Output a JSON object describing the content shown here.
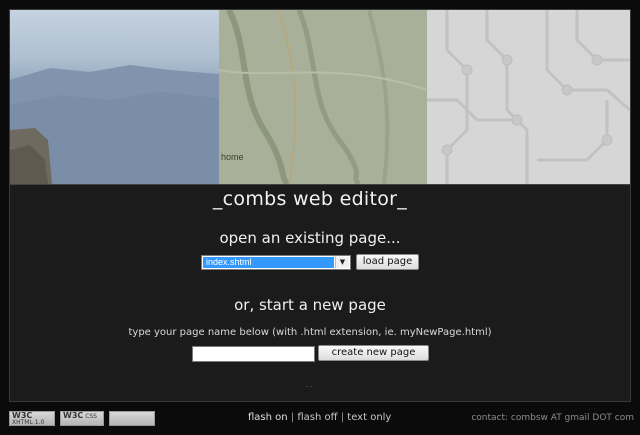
{
  "banner": {
    "home_label": "home"
  },
  "main": {
    "title": "_combs web editor_",
    "open_heading": "open an existing page...",
    "page_select": {
      "selected_value": "index.shtml"
    },
    "load_button": "load page",
    "new_heading": "or, start a new page",
    "hint": "type your page name below (with .html extension, ie. myNewPage.html)",
    "new_page_input": {
      "value": "",
      "placeholder": ""
    },
    "create_button": "create new page",
    "dots": ". ."
  },
  "footer": {
    "badges": [
      {
        "top": "W3C",
        "sub": "XHTML 1.0"
      },
      {
        "top": "W3C",
        "sub": "CSS"
      },
      {
        "top": "",
        "sub": ""
      }
    ],
    "links": {
      "flash_on": "flash on",
      "separator": "|",
      "flash_off": "flash off",
      "text_only": "text only"
    },
    "contact": "contact: combsw AT gmail DOT com"
  },
  "colors": {
    "background": "#0b0b0b",
    "frame": "#1b1b1b",
    "select_highlight": "#3399ff"
  }
}
